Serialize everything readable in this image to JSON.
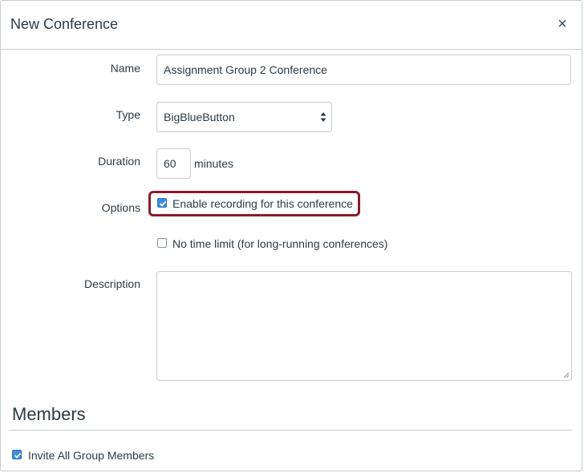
{
  "dialog": {
    "title": "New Conference",
    "close_icon": "close-icon"
  },
  "form": {
    "name_label": "Name",
    "name_value": "Assignment Group 2 Conference",
    "type_label": "Type",
    "type_value": "BigBlueButton",
    "duration_label": "Duration",
    "duration_value": "60",
    "duration_unit": "minutes",
    "options_label": "Options",
    "option_recording": {
      "label": "Enable recording for this conference",
      "checked": true
    },
    "option_no_time_limit": {
      "label": "No time limit (for long-running conferences)",
      "checked": false
    },
    "description_label": "Description",
    "description_value": ""
  },
  "members": {
    "heading": "Members",
    "invite_all": {
      "label": "Invite All Group Members",
      "checked": true
    }
  },
  "colors": {
    "accent_checkbox": "#3c8dde",
    "highlight_border": "#8b1a2b",
    "text": "#2d3b45",
    "border": "#c7cdd1"
  }
}
